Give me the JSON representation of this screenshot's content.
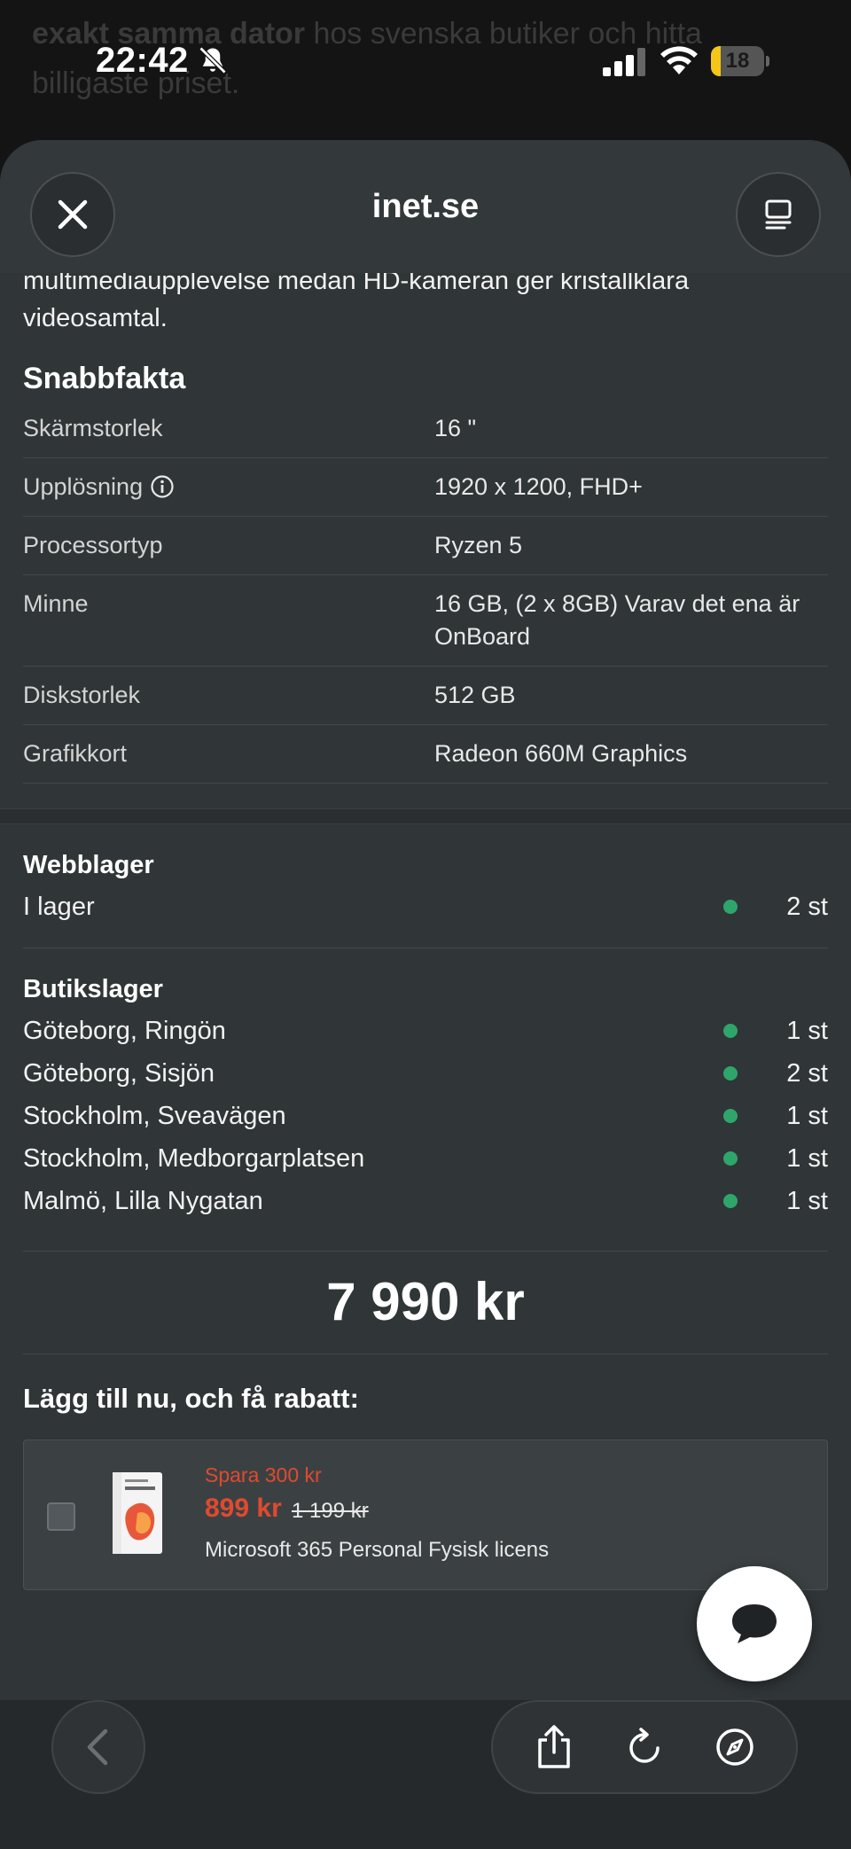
{
  "background_page": {
    "text_bold": "exakt samma dator",
    "text_rest": " hos svenska butiker och hitta billigaste priset."
  },
  "status_bar": {
    "time": "22:42",
    "battery": "18",
    "battery_level": 0.18,
    "icons": [
      "bell-slash-icon",
      "signal-icon",
      "wifi-icon",
      "battery-icon"
    ]
  },
  "sheet": {
    "title": "inet.se",
    "close_icon": "close-icon",
    "reader_icon": "reader-mode-icon"
  },
  "intro_text": "multimediaupplevelse medan HD-kameran ger kristallklara videosamtal.",
  "quick_facts": {
    "title": "Snabbfakta",
    "rows": [
      {
        "label": "Skärmstorlek",
        "value": "16 \""
      },
      {
        "label": "Upplösning",
        "value": "1920 x 1200, FHD+"
      },
      {
        "label": "Processortyp",
        "value": "Ryzen 5"
      },
      {
        "label": "Minne",
        "value": "16 GB, (2 x 8GB) Varav det ena är OnBoard"
      },
      {
        "label": "Diskstorlek",
        "value": "512 GB"
      },
      {
        "label": "Grafikkort",
        "value": "Radeon 660M Graphics"
      }
    ]
  },
  "web_stock": {
    "title": "Webblager",
    "rows": [
      {
        "name": "I lager",
        "qty": "2 st"
      }
    ]
  },
  "store_stock": {
    "title": "Butikslager",
    "rows": [
      {
        "name": "Göteborg, Ringön",
        "qty": "1 st"
      },
      {
        "name": "Göteborg, Sisjön",
        "qty": "2 st"
      },
      {
        "name": "Stockholm, Sveavägen",
        "qty": "1 st"
      },
      {
        "name": "Stockholm, Medborgarplatsen",
        "qty": "1 st"
      },
      {
        "name": "Malmö, Lilla Nygatan",
        "qty": "1 st"
      }
    ]
  },
  "price": "7 990 kr",
  "addon": {
    "title": "Lägg till nu, och få rabatt:",
    "save": "Spara 300 kr",
    "price": "899 kr",
    "old_price": "1 199 kr",
    "name": "Microsoft 365 Personal Fysisk licens"
  },
  "colors": {
    "accent_red": "#e04a2f",
    "stock_green": "#2ea66b",
    "sheet_bg": "#303537",
    "battery_yellow": "#f5c518"
  }
}
